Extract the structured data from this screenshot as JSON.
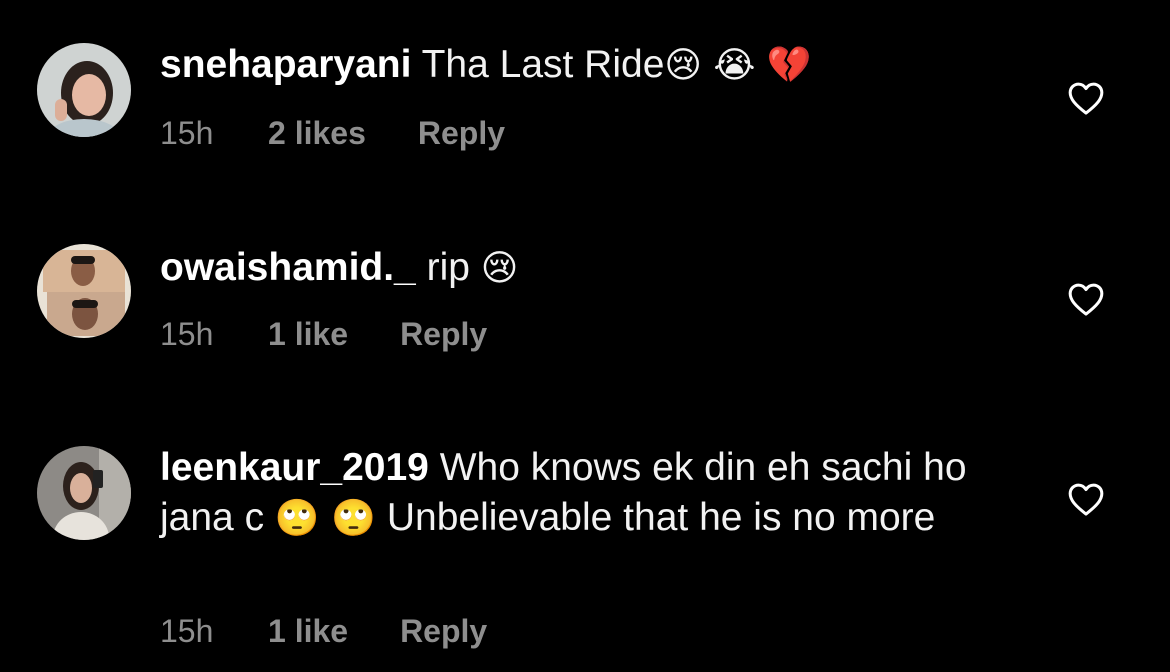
{
  "comments": [
    {
      "username": "snehaparyani",
      "text": "Tha Last Ride",
      "emojis": "😢 😭 💔",
      "time": "15h",
      "likes": "2 likes",
      "reply": "Reply"
    },
    {
      "username": "owaishamid._",
      "text": "rip",
      "emojis": "😢",
      "time": "15h",
      "likes": "1 like",
      "reply": "Reply"
    },
    {
      "username": "leenkaur_2019",
      "text_a": "Who knows ek din eh sachi ho jana c",
      "emojis": "🙄 🙄",
      "text_b": "Unbelievable that he is no more",
      "time": "15h",
      "likes": "1 like",
      "reply": "Reply"
    }
  ],
  "colors": {
    "background": "#000000",
    "text": "#f2f2f2",
    "meta": "#8e8e8e",
    "icon": "#ffffff"
  },
  "icons": {
    "like": "heart-outline-icon"
  }
}
